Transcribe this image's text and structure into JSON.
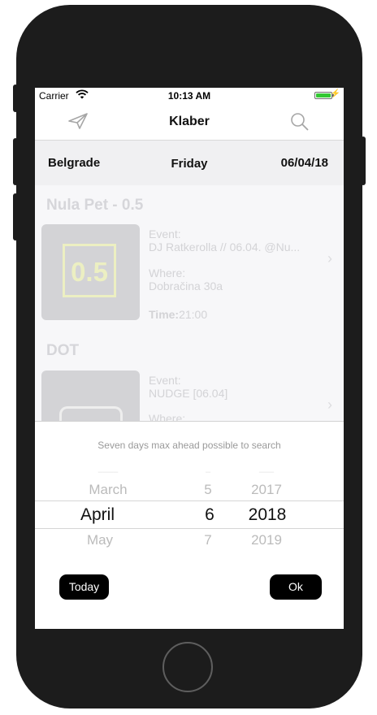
{
  "status_bar": {
    "carrier": "Carrier",
    "time": "10:13 AM",
    "battery_level": 1.0
  },
  "nav": {
    "title": "Klaber",
    "left_icon": "send-icon",
    "right_icon": "search-icon"
  },
  "date_bar": {
    "city": "Belgrade",
    "day": "Friday",
    "date": "06/04/18"
  },
  "venues": [
    {
      "name": "Nula Pet - 0.5",
      "logo_text": "0.5",
      "event_label": "Event:",
      "event_value": "DJ Ratkerolla // 06.04. @Nu...",
      "where_label": "Where:",
      "where_value": "Dobračina 30a",
      "time_label": "Time:",
      "time_value": "21:00"
    },
    {
      "name": "DOT",
      "event_label": "Event:",
      "event_value": "NUDGE [06.04]",
      "where_label": "Where:"
    }
  ],
  "picker": {
    "hint": "Seven days max ahead possible to search",
    "month": {
      "above": "March",
      "selected": "April",
      "below": "May"
    },
    "day": {
      "above": "5",
      "selected": "6",
      "below": "7"
    },
    "year": {
      "above": "2017",
      "selected": "2018",
      "below": "2019"
    },
    "today_label": "Today",
    "ok_label": "Ok"
  }
}
